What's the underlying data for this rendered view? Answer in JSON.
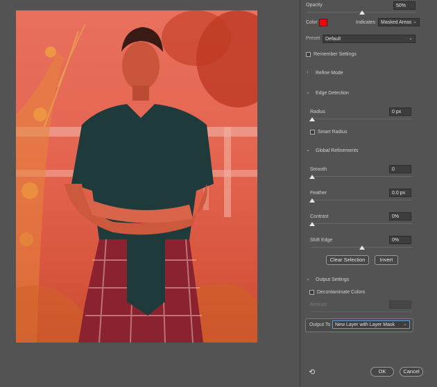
{
  "view": {
    "opacity_label": "Opacity",
    "opacity_value": "50%",
    "opacity_fraction": 0.5,
    "color_label": "Color",
    "overlay_color": "#ff0000",
    "indicates_label": "Indicates",
    "indicates_value": "Masked Areas",
    "preset_label": "Preset",
    "preset_value": "Default",
    "remember_label": "Remember Settings"
  },
  "refine_mode": {
    "title": "Refine Mode"
  },
  "edge_detection": {
    "title": "Edge Detection",
    "radius_label": "Radius",
    "radius_value": "0 px",
    "smart_radius_label": "Smart Radius"
  },
  "global_refinements": {
    "title": "Global Refinements",
    "smooth_label": "Smooth",
    "smooth_value": "0",
    "feather_label": "Feather",
    "feather_value": "0.0 px",
    "contrast_label": "Contrast",
    "contrast_value": "0%",
    "shift_edge_label": "Shift Edge",
    "shift_edge_value": "0%",
    "clear_selection_label": "Clear Selection",
    "invert_label": "Invert"
  },
  "output_settings": {
    "title": "Output Settings",
    "decontaminate_label": "Decontaminate Colors",
    "amount_label": "Amount",
    "output_to_label": "Output To",
    "output_to_value": "New Layer with Layer Mask"
  },
  "footer": {
    "ok_label": "OK",
    "cancel_label": "Cancel"
  },
  "icons": {
    "reset": "reset-icon",
    "chevron_right": "›",
    "chevron_down": "⌄"
  }
}
